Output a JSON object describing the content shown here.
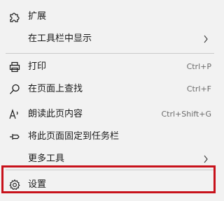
{
  "menu": {
    "extensions": {
      "label": "扩展",
      "icon": "puzzle-icon"
    },
    "show_in_toolbar": {
      "label": "在工具栏中显示",
      "icon": "chevron-right-icon"
    },
    "print": {
      "label": "打印",
      "shortcut": "Ctrl+P",
      "icon": "printer-icon"
    },
    "find_on_page": {
      "label": "在页面上查找",
      "shortcut": "Ctrl+F",
      "icon": "search-icon"
    },
    "read_aloud": {
      "label": "朗读此页内容",
      "shortcut": "Ctrl+Shift+G",
      "icon": "read-aloud-icon"
    },
    "pin_to_taskbar": {
      "label": "将此页面固定到任务栏",
      "icon": "pin-icon"
    },
    "more_tools": {
      "label": "更多工具",
      "icon": "chevron-right-icon"
    },
    "settings": {
      "label": "设置",
      "icon": "gear-icon"
    }
  },
  "colors": {
    "menu_background": "#f2f2f2",
    "text": "#1a1a1a",
    "shortcut_text": "#6b6b6b",
    "divider": "#c9c9c9",
    "highlight_border": "#c8121b"
  }
}
